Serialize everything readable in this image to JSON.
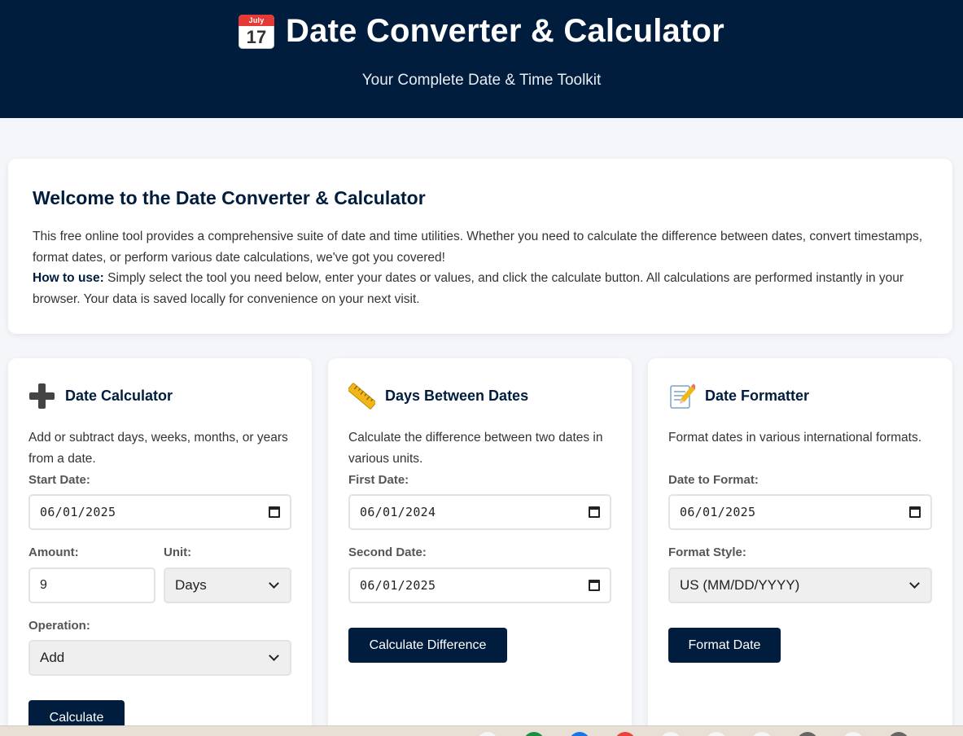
{
  "header": {
    "icon": "calendar-icon",
    "calendar_month": "July",
    "calendar_day": "17",
    "title": "Date Converter & Calculator",
    "subtitle": "Your Complete Date & Time Toolkit"
  },
  "welcome": {
    "heading": "Welcome to the Date Converter & Calculator",
    "intro": "This free online tool provides a comprehensive suite of date and time utilities. Whether you need to calculate the difference between dates, convert timestamps, format dates, or perform various date calculations, we've got you covered!",
    "howto_label": "How to use:",
    "howto_text": " Simply select the tool you need below, enter your dates or values, and click the calculate button. All calculations are performed instantly in your browser. Your data is saved locally for convenience on your next visit."
  },
  "tools": {
    "calculator": {
      "icon": "plus-icon",
      "title": "Date Calculator",
      "description": "Add or subtract days, weeks, months, or years from a date.",
      "start_date_label": "Start Date:",
      "start_date_value": "06/01/2025",
      "amount_label": "Amount:",
      "amount_value": "9",
      "unit_label": "Unit:",
      "unit_value": "Days",
      "operation_label": "Operation:",
      "operation_value": "Add",
      "button": "Calculate"
    },
    "between": {
      "icon": "ruler-icon",
      "title": "Days Between Dates",
      "description": "Calculate the difference between two dates in various units.",
      "first_label": "First Date:",
      "first_value": "06/01/2024",
      "second_label": "Second Date:",
      "second_value": "06/01/2025",
      "button": "Calculate Difference"
    },
    "formatter": {
      "icon": "memo-icon",
      "title": "Date Formatter",
      "description": "Format dates in various international formats.",
      "date_label": "Date to Format:",
      "date_value": "06/01/2025",
      "style_label": "Format Style:",
      "style_value": "US (MM/DD/YYYY)",
      "button": "Format Date"
    }
  },
  "colors": {
    "brand": "#001d3d",
    "background": "#f4f6f9"
  }
}
